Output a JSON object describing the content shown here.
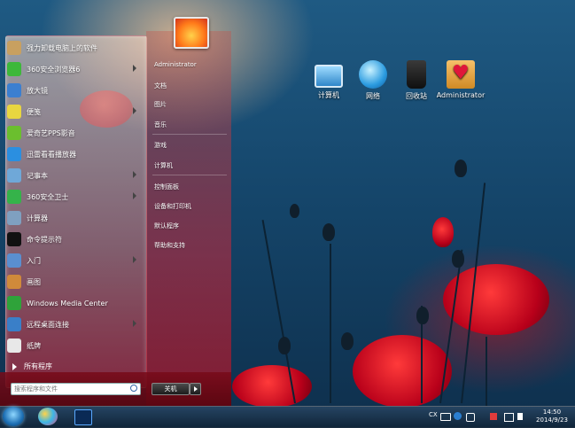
{
  "desktop": {
    "icons": [
      {
        "label": "计算机",
        "icon": "computer-icon"
      },
      {
        "label": "网络",
        "icon": "network-globe-icon"
      },
      {
        "label": "回收站",
        "icon": "recycle-bin-icon"
      },
      {
        "label": "Administrator",
        "icon": "user-folder-icon"
      }
    ]
  },
  "start_menu": {
    "programs": [
      {
        "label": "强力卸载电脑上的软件",
        "icon": "uninstall-icon",
        "color": "#c8a060",
        "submenu": false
      },
      {
        "label": "360安全浏览器6",
        "icon": "360-browser-icon",
        "color": "#3db83a",
        "submenu": true
      },
      {
        "label": "放大镜",
        "icon": "magnifier-icon",
        "color": "#3b7fd0",
        "submenu": false
      },
      {
        "label": "便笺",
        "icon": "sticky-notes-icon",
        "color": "#e8d640",
        "submenu": true
      },
      {
        "label": "爱奇艺PPS影音",
        "icon": "pps-player-icon",
        "color": "#6bbf2e",
        "submenu": false
      },
      {
        "label": "迅雷看看播放器",
        "icon": "xunlei-player-icon",
        "color": "#2b8fe0",
        "submenu": false
      },
      {
        "label": "记事本",
        "icon": "notepad-icon",
        "color": "#6fa8d8",
        "submenu": true
      },
      {
        "label": "360安全卫士",
        "icon": "360-security-icon",
        "color": "#35b34a",
        "submenu": true
      },
      {
        "label": "计算器",
        "icon": "calculator-icon",
        "color": "#7fa0c0",
        "submenu": false
      },
      {
        "label": "命令提示符",
        "icon": "cmd-icon",
        "color": "#111111",
        "submenu": false
      },
      {
        "label": "入门",
        "icon": "getting-started-icon",
        "color": "#5a8fd0",
        "submenu": true
      },
      {
        "label": "画图",
        "icon": "paint-icon",
        "color": "#d08a3a",
        "submenu": false
      },
      {
        "label": "Windows Media Center",
        "icon": "media-center-icon",
        "color": "#2fa33a",
        "submenu": false
      },
      {
        "label": "远程桌面连接",
        "icon": "remote-desktop-icon",
        "color": "#3a7fc8",
        "submenu": true
      },
      {
        "label": "纸牌",
        "icon": "solitaire-icon",
        "color": "#e8e8e8",
        "submenu": false
      }
    ],
    "all_programs": "所有程序",
    "search_placeholder": "搜索程序和文件",
    "shutdown_label": "关机",
    "right_items": [
      "Administrator",
      "文档",
      "图片",
      "音乐",
      "游戏",
      "计算机",
      "控制面板",
      "设备和打印机",
      "默认程序",
      "帮助和支持"
    ]
  },
  "taskbar": {
    "tray": {
      "lang": "CX"
    },
    "clock": {
      "time": "14:50",
      "date": "2014/9/23"
    }
  }
}
